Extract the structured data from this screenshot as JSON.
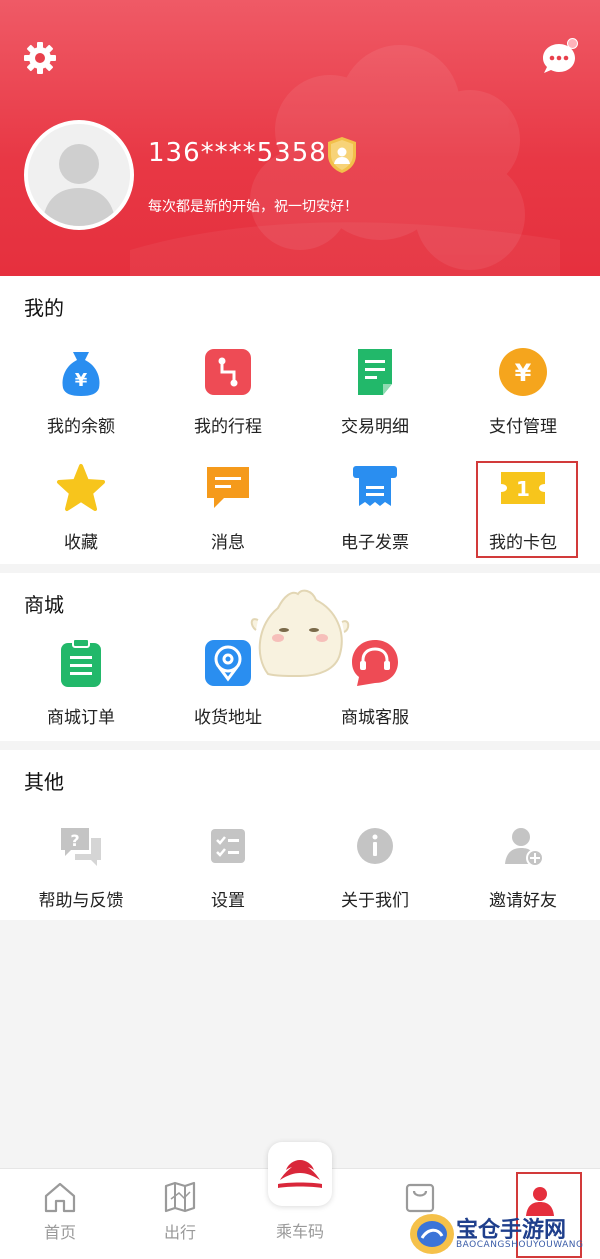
{
  "header": {
    "phone": "136****5358",
    "motto": "每次都是新的开始，祝一切安好！"
  },
  "mine": {
    "title": "我的",
    "items": [
      {
        "label": "我的余额",
        "icon": "money-bag-icon",
        "color": "#2a8ef0"
      },
      {
        "label": "我的行程",
        "icon": "route-icon",
        "color": "#ee4b55"
      },
      {
        "label": "交易明细",
        "icon": "receipt-icon",
        "color": "#22b86a"
      },
      {
        "label": "支付管理",
        "icon": "yuan-coin-icon",
        "color": "#f5a51d"
      },
      {
        "label": "收藏",
        "icon": "star-icon",
        "color": "#f7c51c"
      },
      {
        "label": "消息",
        "icon": "message-icon",
        "color": "#f59a1b"
      },
      {
        "label": "电子发票",
        "icon": "invoice-printer-icon",
        "color": "#2a8ef0"
      },
      {
        "label": "我的卡包",
        "icon": "card-ticket-icon",
        "color": "#f7c51c"
      }
    ]
  },
  "mall": {
    "title": "商城",
    "items": [
      {
        "label": "商城订单",
        "icon": "clipboard-icon",
        "color": "#22b86a"
      },
      {
        "label": "收货地址",
        "icon": "location-icon",
        "color": "#2a8ef0"
      },
      {
        "label": "商城客服",
        "icon": "headset-icon",
        "color": "#ee4b55"
      }
    ]
  },
  "other": {
    "title": "其他",
    "items": [
      {
        "label": "帮助与反馈",
        "icon": "help-feedback-icon",
        "color": "#bdbdbd"
      },
      {
        "label": "设置",
        "icon": "settings-checklist-icon",
        "color": "#bdbdbd"
      },
      {
        "label": "关于我们",
        "icon": "info-icon",
        "color": "#bdbdbd"
      },
      {
        "label": "邀请好友",
        "icon": "invite-user-icon",
        "color": "#bdbdbd"
      }
    ]
  },
  "tabbar": {
    "home": "首页",
    "travel": "出行",
    "ride_code": "乘车码",
    "active_color": "#e52f3d"
  },
  "watermark": {
    "title": "宝仓手游网",
    "sub": "BAOCANGSHOUYOUWANG"
  }
}
